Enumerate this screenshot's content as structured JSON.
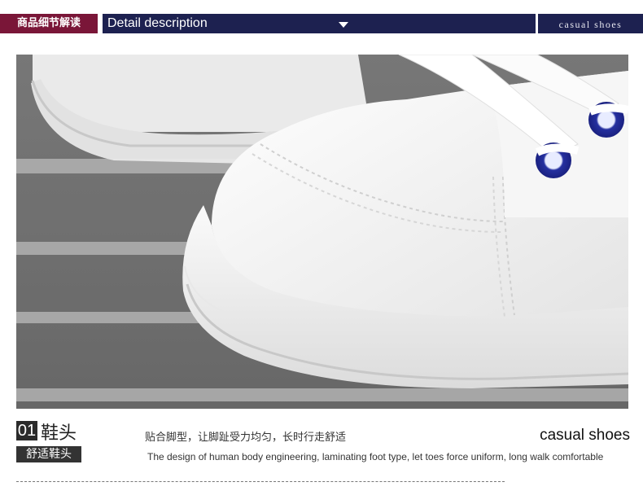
{
  "header": {
    "left_label": "商品细节解读",
    "mid_label": "Detail description",
    "right_label": "casual shoes"
  },
  "section": {
    "number": "01",
    "title": "鞋头",
    "subtitle": "舒适鞋头",
    "desc_cn": "贴合脚型，让脚趾受力均匀，长时行走舒适",
    "desc_en": "The design of human body engineering, laminating foot type, let toes force uniform, long walk comfortable",
    "brand": "casual shoes"
  },
  "colors": {
    "header_left_bg": "#7a1638",
    "header_dark_bg": "#1d2150",
    "eyelet_blue": "#2530a0"
  },
  "icons": {
    "dropdown": "caret-down-icon"
  }
}
